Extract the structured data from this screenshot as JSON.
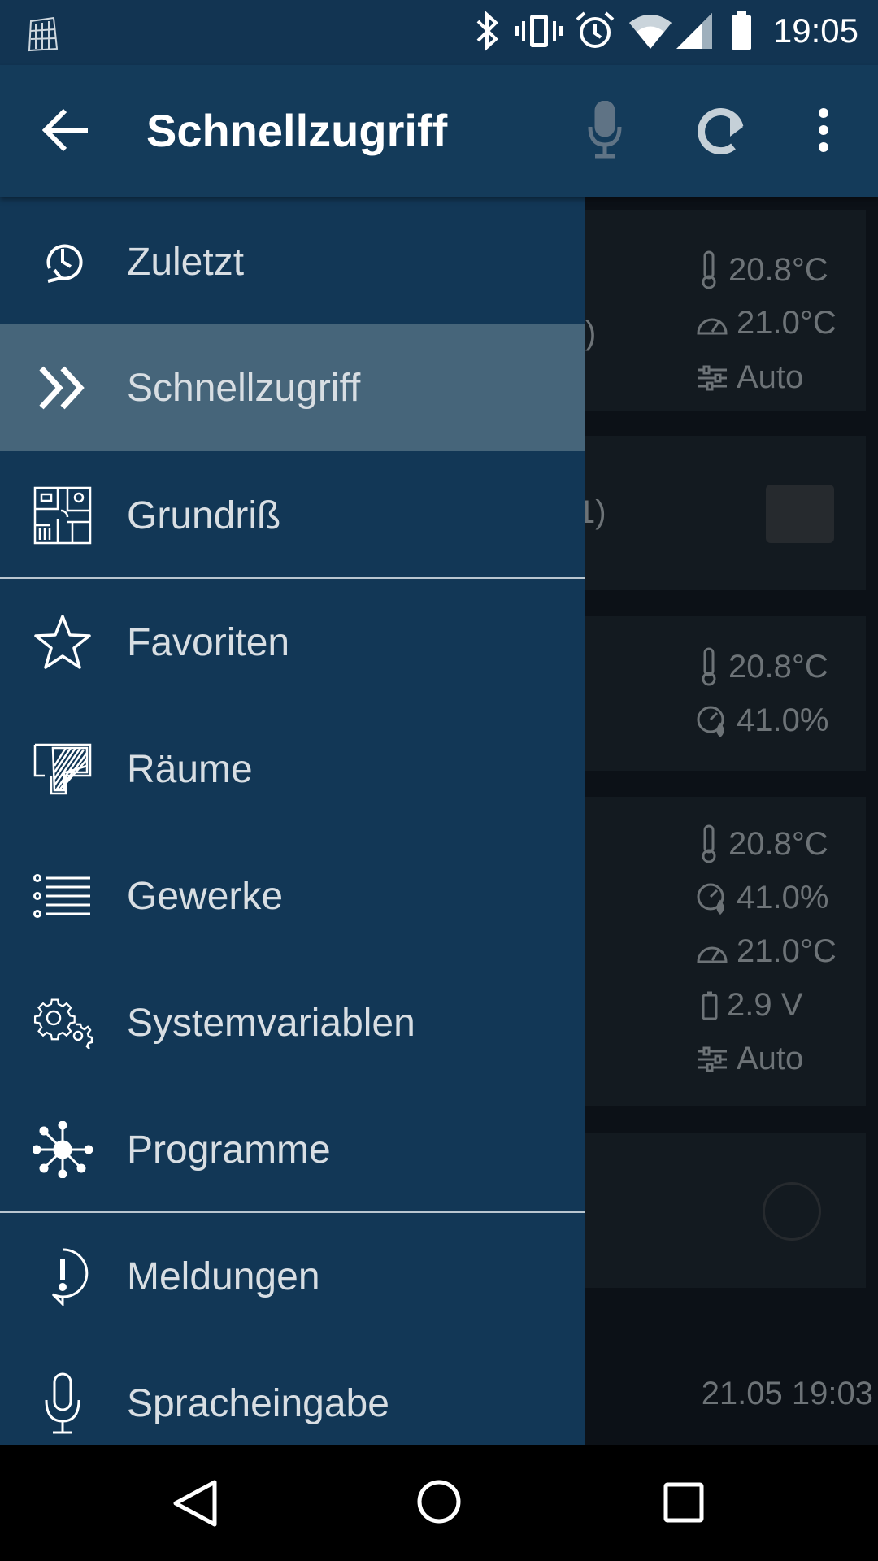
{
  "status_bar": {
    "time": "19:05"
  },
  "app_bar": {
    "title": "Schnellzugriff",
    "icons": [
      "back-arrow-icon",
      "microphone-icon",
      "refresh-icon",
      "more-vert-icon"
    ]
  },
  "drawer": {
    "items": [
      {
        "label": "Zuletzt",
        "icon": "recent-icon"
      },
      {
        "label": "Schnellzugriff",
        "icon": "double-chevron-icon",
        "active": true
      },
      {
        "label": "Grundriß",
        "icon": "floorplan-icon"
      },
      {
        "label": "Favoriten",
        "icon": "star-icon"
      },
      {
        "label": "Räume",
        "icon": "rooms-icon"
      },
      {
        "label": "Gewerke",
        "icon": "list-icon"
      },
      {
        "label": "Systemvariablen",
        "icon": "gears-icon"
      },
      {
        "label": "Programme",
        "icon": "network-icon"
      },
      {
        "label": "Meldungen",
        "icon": "alert-icon"
      },
      {
        "label": "Spracheingabe",
        "icon": "microphone-icon"
      }
    ]
  },
  "background": {
    "card1": {
      "temp": "20.8°C",
      "setpoint": "21.0°C",
      "mode": "Auto",
      "partial": ")"
    },
    "card2": {
      "partial": "1)"
    },
    "card3": {
      "temp": "20.8°C",
      "humidity": "41.0%"
    },
    "card4": {
      "temp": "20.8°C",
      "humidity": "41.0%",
      "setpoint": "21.0°C",
      "battery": "2.9 V",
      "mode": "Auto"
    },
    "timestamp": "21.05 19:03"
  }
}
